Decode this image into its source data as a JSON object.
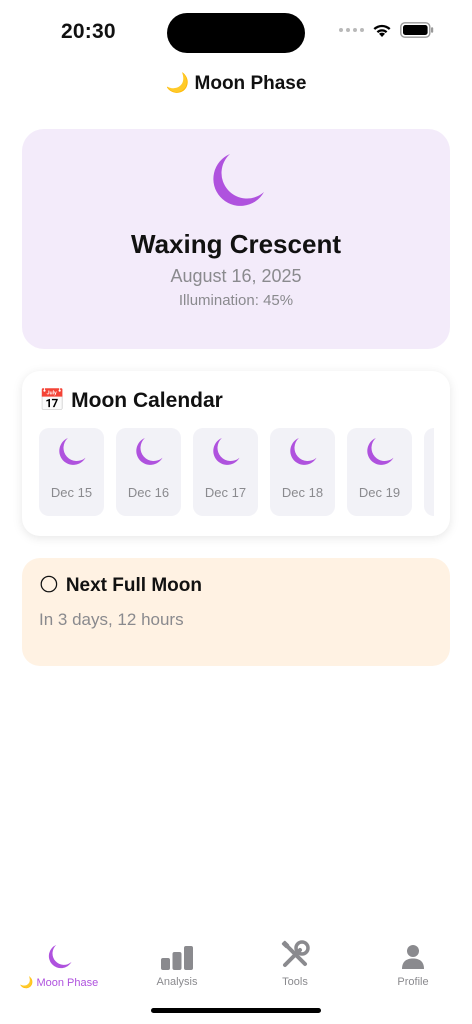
{
  "status_bar": {
    "time": "20:30"
  },
  "header": {
    "title": "🌙 Moon Phase"
  },
  "current_phase": {
    "name": "Waxing Crescent",
    "date": "August 16, 2025",
    "illumination": "Illumination: 45%"
  },
  "calendar": {
    "emoji": "📅",
    "title": "Moon Calendar",
    "days": [
      {
        "label": "Dec 15"
      },
      {
        "label": "Dec 16"
      },
      {
        "label": "Dec 17"
      },
      {
        "label": "Dec 18"
      },
      {
        "label": "Dec 19"
      }
    ]
  },
  "next_full_moon": {
    "emoji": "🌕",
    "title": "Next Full Moon",
    "countdown": "In 3 days, 12 hours"
  },
  "tabs": [
    {
      "label": "🌙 Moon Phase",
      "icon": "moon-icon",
      "active": true
    },
    {
      "label": "Analysis",
      "icon": "chart-icon",
      "active": false
    },
    {
      "label": "Tools",
      "icon": "tools-icon",
      "active": false
    },
    {
      "label": "Profile",
      "icon": "person-icon",
      "active": false
    }
  ],
  "colors": {
    "accent": "#af52de",
    "hero_bg": "#f3ebfa",
    "full_moon_bg": "#fff2e3",
    "muted": "#8a8a8e"
  }
}
